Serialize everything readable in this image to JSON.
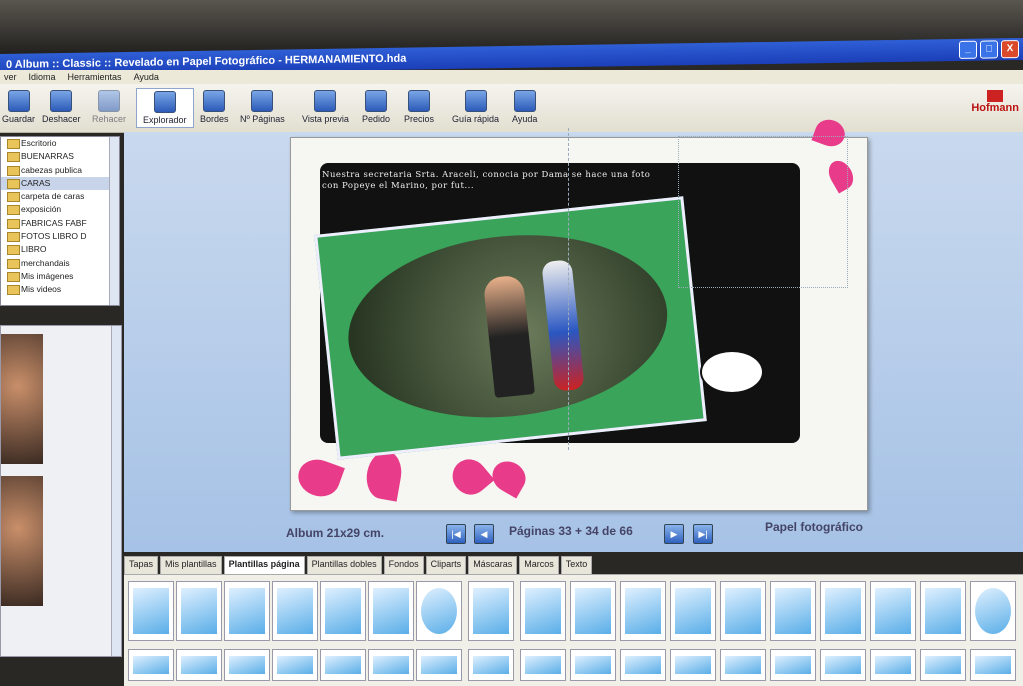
{
  "window": {
    "title": "0    Album :: Classic :: Revelado en Papel Fotográfico   -   HERMANAMIENTO.hda",
    "controls": [
      "_",
      "□",
      "X"
    ]
  },
  "menu": [
    "ver",
    "Idioma",
    "Herramientas",
    "Ayuda"
  ],
  "toolbar": {
    "items": [
      {
        "label": "Guardar",
        "icon": "save-icon"
      },
      {
        "label": "Deshacer",
        "icon": "undo-icon"
      },
      {
        "label": "Rehacer",
        "icon": "redo-icon"
      },
      {
        "label": "Explorador",
        "icon": "explorer-icon"
      },
      {
        "label": "Bordes",
        "icon": "borders-icon"
      },
      {
        "label": "Nº Páginas",
        "icon": "pages-icon"
      },
      {
        "label": "Vista previa",
        "icon": "preview-icon"
      },
      {
        "label": "Pedido",
        "icon": "order-icon"
      },
      {
        "label": "Precios",
        "icon": "euro-icon"
      },
      {
        "label": "Guía rápida",
        "icon": "guide-icon"
      },
      {
        "label": "Ayuda",
        "icon": "help-icon"
      }
    ],
    "brand": "Hofmann"
  },
  "folders": [
    "Escritorio",
    "BUENARRAS",
    "cabezas publica",
    "CARAS",
    "carpeta de caras",
    "exposición",
    "FABRICAS FABF",
    "FOTOS LIBRO D",
    "LIBRO",
    "merchandais",
    "Mis imágenes",
    "Mis videos"
  ],
  "selected_folder": "CARAS",
  "page_caption": "Nuestra secretaria Srta. Araceli, conocia por Dama se hace una foto con Popeye el Marino, por fut...",
  "status": {
    "album_size": "Album 21x29 cm.",
    "pages": "Páginas 33 + 34 de 66",
    "paper": "Papel fotográfico"
  },
  "tabs": [
    "Tapas",
    "Mis plantillas",
    "Plantillas página",
    "Plantillas dobles",
    "Fondos",
    "Cliparts",
    "Máscaras",
    "Marcos",
    "Texto"
  ],
  "active_tab": "Plantillas página",
  "colors": {
    "title_blue": "#1b3fb8",
    "canvas_blue": "#a6c2e6",
    "accent_pink": "#e83c8a",
    "frame_green": "#3aa45a"
  }
}
